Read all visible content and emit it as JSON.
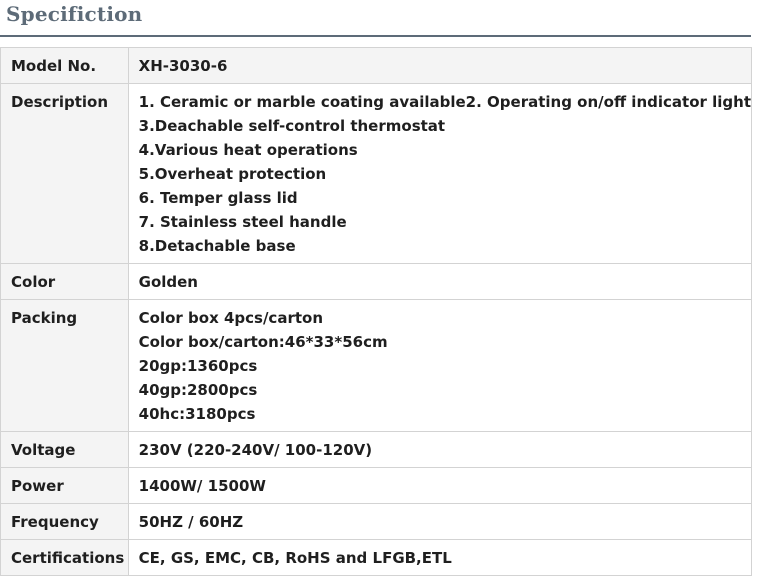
{
  "heading": "Specifiction",
  "rows": [
    {
      "label": "Model No.",
      "lines": [
        "XH-3030-6"
      ]
    },
    {
      "label": "Description",
      "lines": [
        "1. Ceramic or marble coating available2. Operating on/off indicator light",
        "3.Deachable self-control thermostat",
        "4.Various heat operations",
        "5.Overheat protection",
        "6. Temper glass lid",
        "7. Stainless steel handle",
        "8.Detachable base"
      ]
    },
    {
      "label": "Color",
      "lines": [
        "Golden"
      ]
    },
    {
      "label": "Packing",
      "lines": [
        "Color box 4pcs/carton",
        "Color box/carton:46*33*56cm",
        "20gp:1360pcs",
        "40gp:2800pcs",
        "40hc:3180pcs"
      ]
    },
    {
      "label": "Voltage",
      "lines": [
        "230V (220-240V/ 100-120V)"
      ]
    },
    {
      "label": "Power",
      "lines": [
        "1400W/ 1500W"
      ]
    },
    {
      "label": "Frequency",
      "lines": [
        "50HZ / 60HZ"
      ]
    },
    {
      "label": "Certifications",
      "lines": [
        "CE, GS, EMC, CB, RoHS and LFGB,ETL"
      ]
    }
  ]
}
